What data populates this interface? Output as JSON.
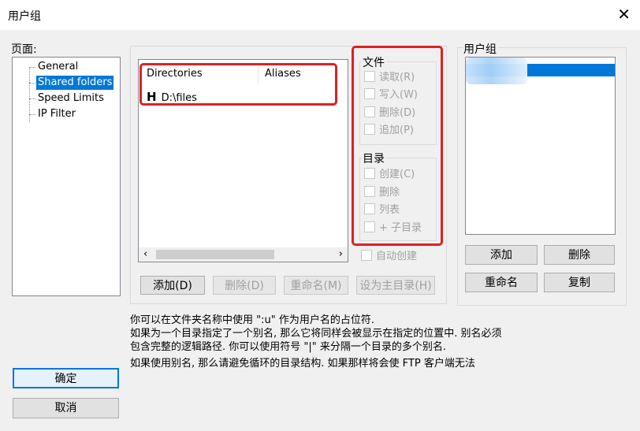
{
  "window": {
    "title": "用户组",
    "close_glyph": "✕"
  },
  "pages": {
    "label": "页面:",
    "items": [
      {
        "label": "General",
        "selected": false
      },
      {
        "label": "Shared folders",
        "selected": true
      },
      {
        "label": "Speed Limits",
        "selected": false
      },
      {
        "label": "IP Filter",
        "selected": false
      }
    ]
  },
  "directories": {
    "columns": [
      "Directories",
      "Aliases"
    ],
    "rows": [
      {
        "marker": "H",
        "path": "D:\\files",
        "alias": ""
      }
    ],
    "scroll_left": "‹",
    "scroll_right": "›"
  },
  "files": {
    "title": "文件",
    "options": [
      {
        "label": "读取(R)"
      },
      {
        "label": "写入(W)"
      },
      {
        "label": "删除(D)"
      },
      {
        "label": "追加(P)"
      }
    ]
  },
  "dirs_perm": {
    "title": "目录",
    "options": [
      {
        "label": "创建(C)"
      },
      {
        "label": "删除"
      },
      {
        "label": "列表"
      },
      {
        "label": "+ 子目录"
      }
    ]
  },
  "auto_create": "自动创建",
  "buttons": {
    "add": "添加(D)",
    "remove": "删除(D)",
    "rename": "重命名(M)",
    "set_home": "设为主目录(H)"
  },
  "groups": {
    "title": "用户组",
    "add": "添加",
    "remove": "删除",
    "rename": "重命名",
    "copy": "复制"
  },
  "info": {
    "line1": "你可以在文件夹名称中使用 \":u\" 作为用户名的占位符.",
    "line2": "如果为一个目录指定了一个别名, 那么它将同样会被显示在指定的位置中. 别名必须",
    "line3": "包含完整的逻辑路径. 你可以使用符号 \"|\" 来分隔一个目录的多个别名.",
    "line4": "如果使用别名, 那么请避免循环的目录结构. 如果那样将会使 FTP 客户端无法"
  },
  "dialog": {
    "ok": "确定",
    "cancel": "取消"
  },
  "colors": {
    "highlight": "#e02020",
    "selection": "#0078d7"
  }
}
